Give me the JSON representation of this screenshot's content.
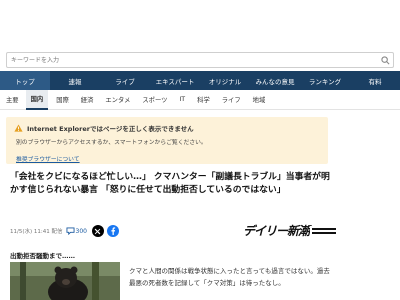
{
  "search": {
    "placeholder": "キーワードを入力"
  },
  "main_nav": [
    {
      "label": "トップ",
      "active": true
    },
    {
      "label": "速報",
      "active": false
    },
    {
      "label": "ライブ",
      "active": false
    },
    {
      "label": "エキスパート",
      "active": false
    },
    {
      "label": "オリジナル",
      "active": false
    },
    {
      "label": "みんなの意見",
      "active": false
    },
    {
      "label": "ランキング",
      "active": false
    },
    {
      "label": "有料",
      "active": false
    }
  ],
  "sub_nav": [
    {
      "label": "主要",
      "active": false
    },
    {
      "label": "国内",
      "active": true
    },
    {
      "label": "国際",
      "active": false
    },
    {
      "label": "経済",
      "active": false
    },
    {
      "label": "エンタメ",
      "active": false
    },
    {
      "label": "スポーツ",
      "active": false
    },
    {
      "label": "IT",
      "active": false
    },
    {
      "label": "科学",
      "active": false
    },
    {
      "label": "ライフ",
      "active": false
    },
    {
      "label": "地域",
      "active": false
    }
  ],
  "notice": {
    "title": "Internet Explorerではページを正しく表示できません",
    "body": "別のブラウザーからアクセスするか、スマートフォンからご覧ください。",
    "link": "推奨ブラウザーについて",
    "color": "#fdf2d9"
  },
  "article": {
    "headline": "「会社をクビになるほど忙しい…」 クマハンター「副議長トラブル」当事者が明かす信じられない暴言 「怒りに任せて出動拒否しているのではない」",
    "date": "11/5(水) 11:41 配信",
    "comment_count": "300",
    "source_logo": "デイリー新潮",
    "section_label": "出動拒否騒動まで……",
    "body": "クマと人間の関係は戦争状態に入ったと言っても過言ではない。過去最悪の死者数を記録して「クマ対策」は待ったなし。"
  },
  "colors": {
    "nav_bg": "#1a3f63",
    "nav_active": "#2d5a86",
    "link": "#1a5aa0"
  }
}
